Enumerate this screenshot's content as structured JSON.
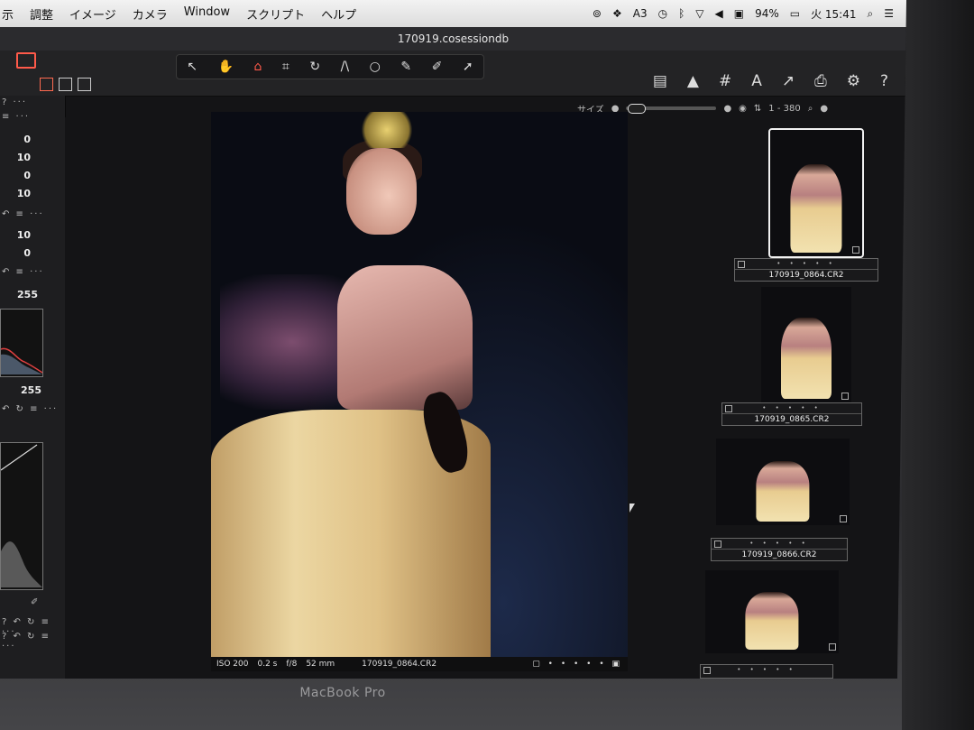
{
  "menubar": {
    "menus": [
      "示",
      "調整",
      "イメージ",
      "カメラ",
      "Window",
      "スクリプト",
      "ヘルプ"
    ],
    "status": {
      "adobe_count": "3",
      "battery": "94%",
      "clock": "火 15:41"
    }
  },
  "app": {
    "window_title": "170919.cosessiondb",
    "size_label": "サイズ",
    "image_range": "1 - 380"
  },
  "left_panel": {
    "values_a": [
      "0",
      "10",
      "0",
      "10"
    ],
    "values_b": [
      "10",
      "0"
    ],
    "levels_top": "255",
    "levels_bottom": "255"
  },
  "viewer": {
    "iso": "ISO 200",
    "shutter": "0.2 s",
    "aperture": "f/8",
    "focal": "52 mm",
    "filename": "170919_0864.CR2"
  },
  "filmstrip": {
    "rating_dots": "• • • • •",
    "items": [
      {
        "filename": "170919_0864.CR2",
        "selected": true
      },
      {
        "filename": "170919_0865.CR2",
        "selected": false
      },
      {
        "filename": "170919_0866.CR2",
        "selected": false
      },
      {
        "filename": "",
        "selected": false
      }
    ]
  },
  "device": {
    "label": "MacBook Pro"
  },
  "colors": {
    "accent": "#ff5a4a",
    "panel": "#1e1e20",
    "menubar": "#e8e8e8"
  }
}
